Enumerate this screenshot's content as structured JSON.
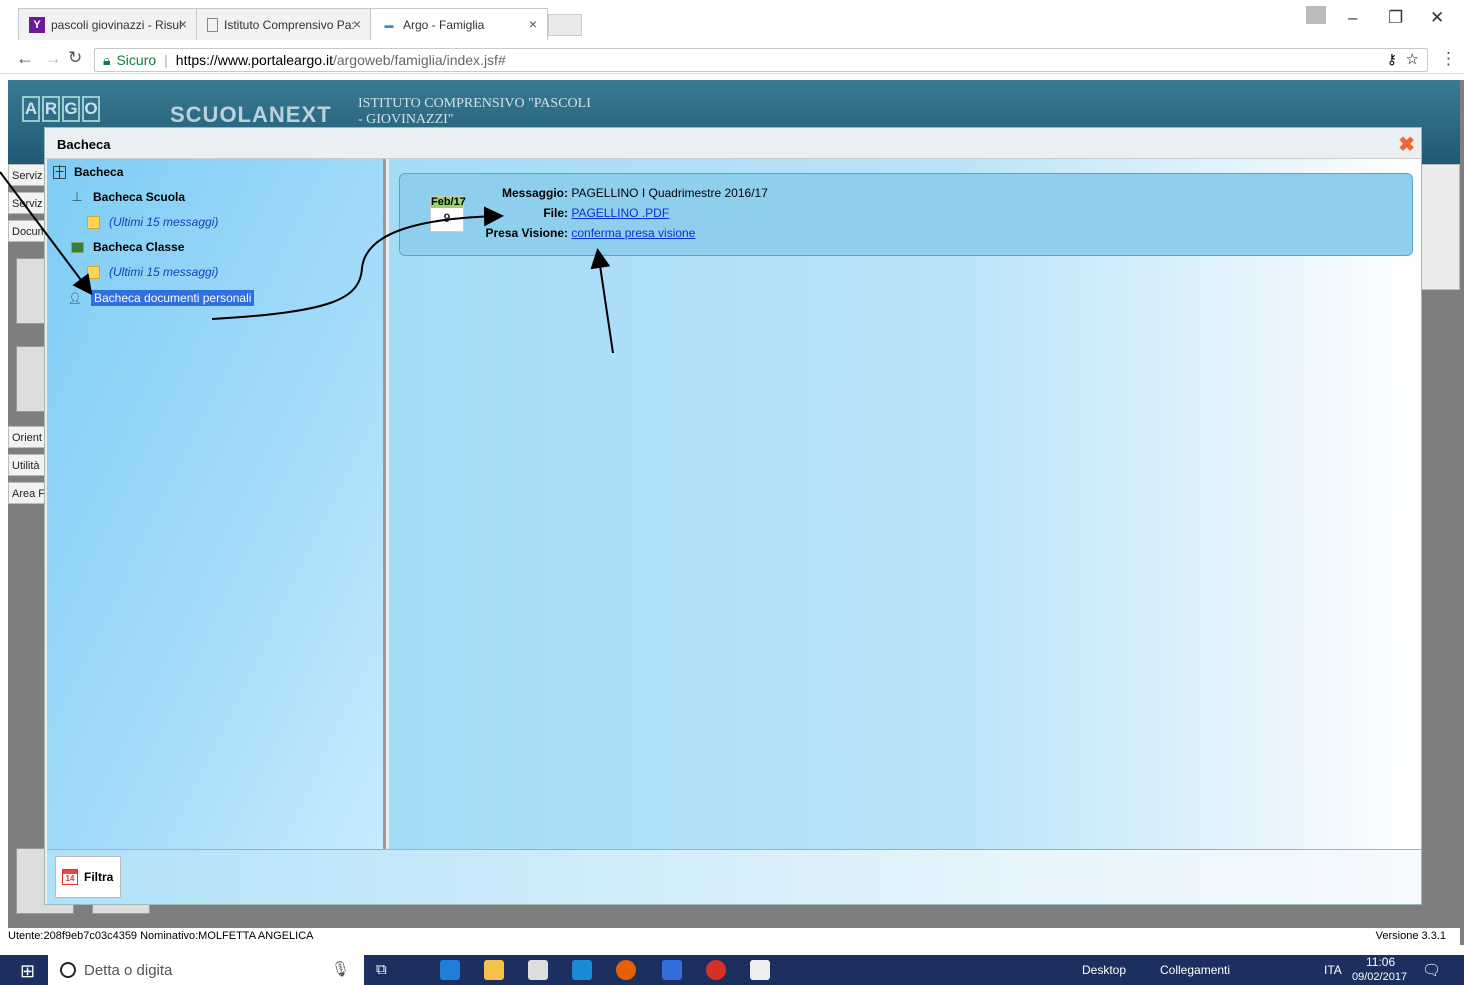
{
  "browser": {
    "tabs": [
      {
        "label": "pascoli giovinazzi - Risul",
        "favicon": "Y",
        "active": false
      },
      {
        "label": "Istituto Comprensivo Pa:",
        "favicon": "page",
        "active": false
      },
      {
        "label": "Argo - Famiglia",
        "favicon": "argo",
        "active": true
      }
    ],
    "tab_close": "×",
    "address": {
      "secure_label": "Sicuro",
      "scheme_host": "https://www.portaleargo.it",
      "path": "/argoweb/famiglia/index.jsf#"
    }
  },
  "app": {
    "logo_letters": [
      "A",
      "R",
      "G",
      "O"
    ],
    "brand": "SCUOLANEXT",
    "institute": "ISTITUTO COMPRENSIVO \"PASCOLI - GIOVINAZZI\"",
    "side_menu": [
      "Serviz",
      "Serviz",
      "Docum",
      "Orient",
      "Utilità",
      "Area F"
    ],
    "status_user": "Utente:208f9eb7c03c4359 Nominativo:MOLFETTA ANGELICA",
    "version": "Versione 3.3.1"
  },
  "dialog": {
    "title": "Bacheca",
    "close": "✖",
    "tree": {
      "root": "Bacheca",
      "school": "Bacheca Scuola",
      "school_recent": "(Ultimi 15 messaggi)",
      "class": "Bacheca Classe",
      "class_recent": "(Ultimi 15 messaggi)",
      "personal": "Bacheca documenti personali"
    },
    "message": {
      "calendar_month": "Feb/17",
      "calendar_day": "9",
      "message_label": "Messaggio:",
      "message_value": "PAGELLINO I Quadrimestre 2016/17",
      "file_label": "File:",
      "file_value": "PAGELLINO .PDF",
      "ack_label": "Presa Visione:",
      "ack_value": "conferma presa visione"
    },
    "filter_button": "Filtra",
    "filter_day": "14"
  },
  "taskbar": {
    "search_placeholder": "Detta o digita",
    "desktop": "Desktop",
    "links": "Collegamenti",
    "lang": "ITA",
    "time": "11:06",
    "date": "09/02/2017"
  }
}
